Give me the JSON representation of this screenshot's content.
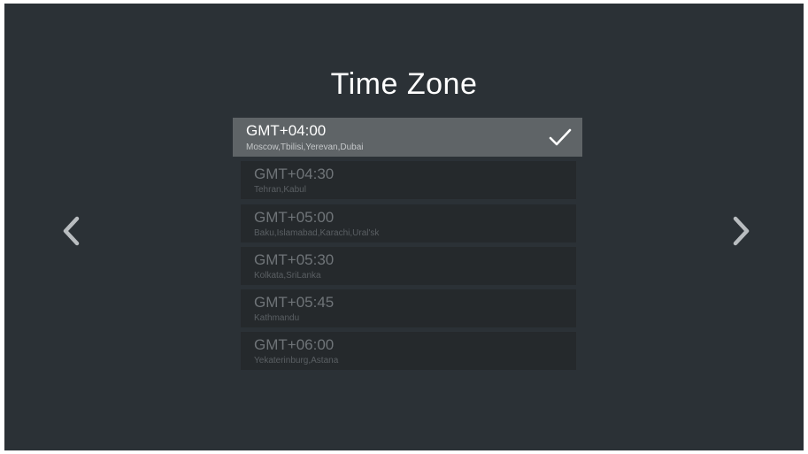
{
  "title": "Time Zone",
  "selected_index": 0,
  "icons": {
    "selected_marker": "checkmark-icon",
    "prev": "chevron-left-icon",
    "next": "chevron-right-icon"
  },
  "colors": {
    "background": "#2b3136",
    "item_background": "#25292c",
    "selected_background": "#5f6467",
    "text": "#ffffff"
  },
  "timezones": [
    {
      "offset": "GMT+04:00",
      "cities": "Moscow,Tbilisi,Yerevan,Dubai"
    },
    {
      "offset": "GMT+04:30",
      "cities": "Tehran,Kabul"
    },
    {
      "offset": "GMT+05:00",
      "cities": "Baku,Islamabad,Karachi,Ural'sk"
    },
    {
      "offset": "GMT+05:30",
      "cities": "Kolkata,SriLanka"
    },
    {
      "offset": "GMT+05:45",
      "cities": "Kathmandu"
    },
    {
      "offset": "GMT+06:00",
      "cities": "Yekaterinburg,Astana"
    }
  ]
}
